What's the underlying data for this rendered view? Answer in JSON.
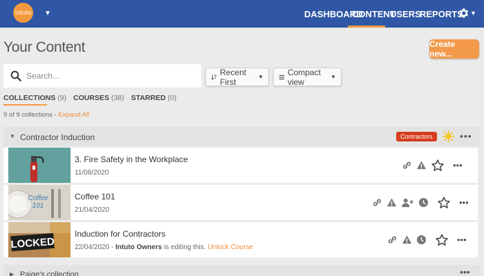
{
  "nav": {
    "logo_text": "intuto",
    "items": [
      "DASHBOARD",
      "CONTENT",
      "USERS",
      "REPORTS"
    ],
    "active": "CONTENT"
  },
  "header": {
    "title": "Your Content",
    "create_label": "Create new..."
  },
  "search": {
    "placeholder": "Search..."
  },
  "filters": {
    "sort_label": "Recent First",
    "view_label": "Compact view"
  },
  "tabs": [
    {
      "label": "COLLECTIONS",
      "count": "(9)"
    },
    {
      "label": "COURSES",
      "count": "(38)"
    },
    {
      "label": "STARRED",
      "count": "(0)"
    }
  ],
  "summary": {
    "text": "9 of 9 collections - ",
    "expand_all": "Expand All"
  },
  "collections": [
    {
      "title": "Contractor Induction",
      "tag": "Contractors",
      "courses": [
        {
          "title": "3. Fire Safety in the Workplace",
          "date": "11/08/2020"
        },
        {
          "title": "Coffee 101",
          "date": "21/04/2020"
        },
        {
          "title": "Induction for Contractors",
          "date": "22/04/2020",
          "editor_prefix": " - ",
          "editor": "Intuto Owners",
          "editing_text": " is editing this. ",
          "unlock_label": "Unlock Course"
        }
      ]
    },
    {
      "title": "Paige's collection"
    }
  ],
  "thumbnails": {
    "coffee_text": "Coffee\n101",
    "locked_text": "LOCKED"
  },
  "colors": {
    "nav": "#2f57a6",
    "accent": "#f39a3e",
    "tag": "#d63c1e"
  }
}
